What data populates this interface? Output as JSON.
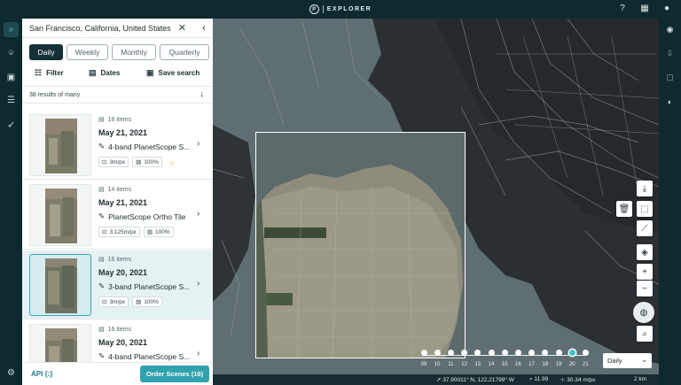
{
  "app": {
    "name": "EXPLORER",
    "logo_letter": "P"
  },
  "header_icons": [
    "help-icon",
    "apps-grid-icon",
    "user-avatar-icon"
  ],
  "left_rail": [
    "search-icon",
    "location-pin-icon",
    "gallery-icon",
    "layers-list-icon",
    "rocket-icon",
    "settings-icon"
  ],
  "right_rail": [
    "eye-icon",
    "export-icon",
    "image-icon",
    "compare-icon"
  ],
  "search": {
    "query": "San Francisco, California, United States"
  },
  "tabs": [
    {
      "label": "Daily",
      "active": true
    },
    {
      "label": "Weekly",
      "active": false
    },
    {
      "label": "Monthly",
      "active": false
    },
    {
      "label": "Quarterly",
      "active": false
    }
  ],
  "toolbar": {
    "filter_label": "Filter",
    "dates_label": "Dates",
    "save_search_label": "Save search"
  },
  "results_text": "38 results of many",
  "scenes": [
    {
      "items": "16 items",
      "date": "May 21, 2021",
      "product": "4-band PlanetScope S...",
      "resolution": "3m/px",
      "coverage": "100%",
      "cloud_icon": true,
      "selected": false
    },
    {
      "items": "14 items",
      "date": "May 21, 2021",
      "product": "PlanetScope Ortho Tile",
      "resolution": "3.125m/px",
      "coverage": "100%",
      "cloud_icon": false,
      "selected": false
    },
    {
      "items": "16 items",
      "date": "May 20, 2021",
      "product": "3-band PlanetScope S...",
      "resolution": "3m/px",
      "coverage": "100%",
      "cloud_icon": false,
      "selected": true
    },
    {
      "items": "16 items",
      "date": "May 20, 2021",
      "product": "4-band PlanetScope S...",
      "resolution": "",
      "coverage": "",
      "cloud_icon": false,
      "selected": false
    }
  ],
  "footer": {
    "api_label": "API {:}",
    "order_label": "Order Scenes (16)"
  },
  "timeline": {
    "days": [
      "09",
      "10",
      "11",
      "12",
      "13",
      "14",
      "15",
      "16",
      "17",
      "18",
      "19",
      "20",
      "21"
    ],
    "active_day": "20",
    "interval_value": "Daily"
  },
  "status_bar": {
    "coordinates": "37.90011° N, 122.21799° W",
    "zoom": "11.99",
    "resolution": "30.34 m/px",
    "scale": "2 km"
  },
  "map_controls": [
    "download-icon",
    "delete-icon",
    "select-area-icon",
    "ruler-icon",
    "layers-icon",
    "zoom-in-icon",
    "zoom-out-icon",
    "globe-icon",
    "zoom-search-icon"
  ]
}
